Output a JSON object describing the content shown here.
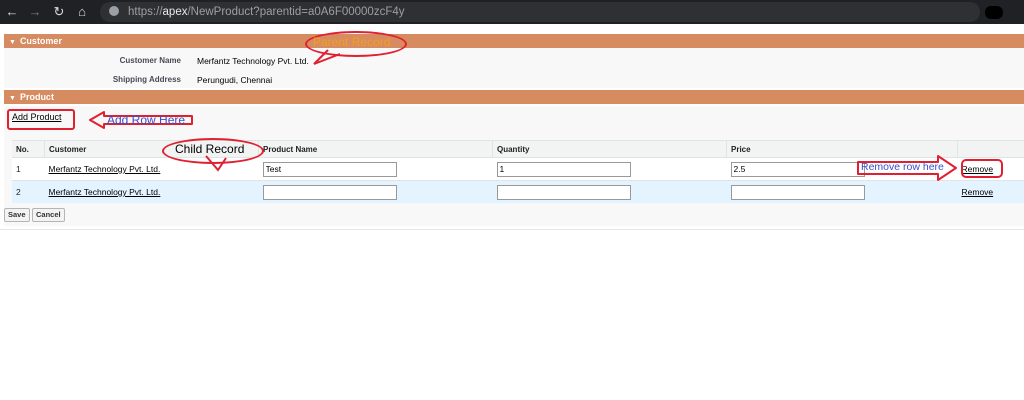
{
  "browser": {
    "url_scheme": "https://",
    "url_host": "apex",
    "url_path": "/NewProduct?parentid=a0A6F00000zcF4y"
  },
  "customer_section": {
    "header": "Customer",
    "fields": [
      {
        "label": "Customer Name",
        "value": "Merfantz Technology Pvt. Ltd."
      },
      {
        "label": "Shipping Address",
        "value": "Perungudi, Chennai"
      }
    ]
  },
  "product_section": {
    "header": "Product",
    "add_link": "Add Product",
    "columns": [
      "No.",
      "Customer",
      "Product Name",
      "Quantity",
      "Price",
      ""
    ],
    "rows": [
      {
        "no": "1",
        "customer": "Merfantz Technology Pvt. Ltd.",
        "product_name": "Test",
        "quantity": "1",
        "price": "2.5",
        "action": "Remove"
      },
      {
        "no": "2",
        "customer": "Merfantz Technology Pvt. Ltd.",
        "product_name": "",
        "quantity": "",
        "price": "",
        "action": "Remove"
      }
    ]
  },
  "buttons": {
    "save": "Save",
    "cancel": "Cancel"
  },
  "annotations": {
    "parent_record": "Parent Record",
    "add_row": "Add Row Here",
    "child_record": "Child Record",
    "remove_row": "Remove row here",
    "color_red": "#e02030",
    "color_orange": "#f0a020",
    "color_blue": "#3a4ec8"
  },
  "theme": {
    "section_header": "#d68b60",
    "selected_row": "#e3f3ff"
  }
}
